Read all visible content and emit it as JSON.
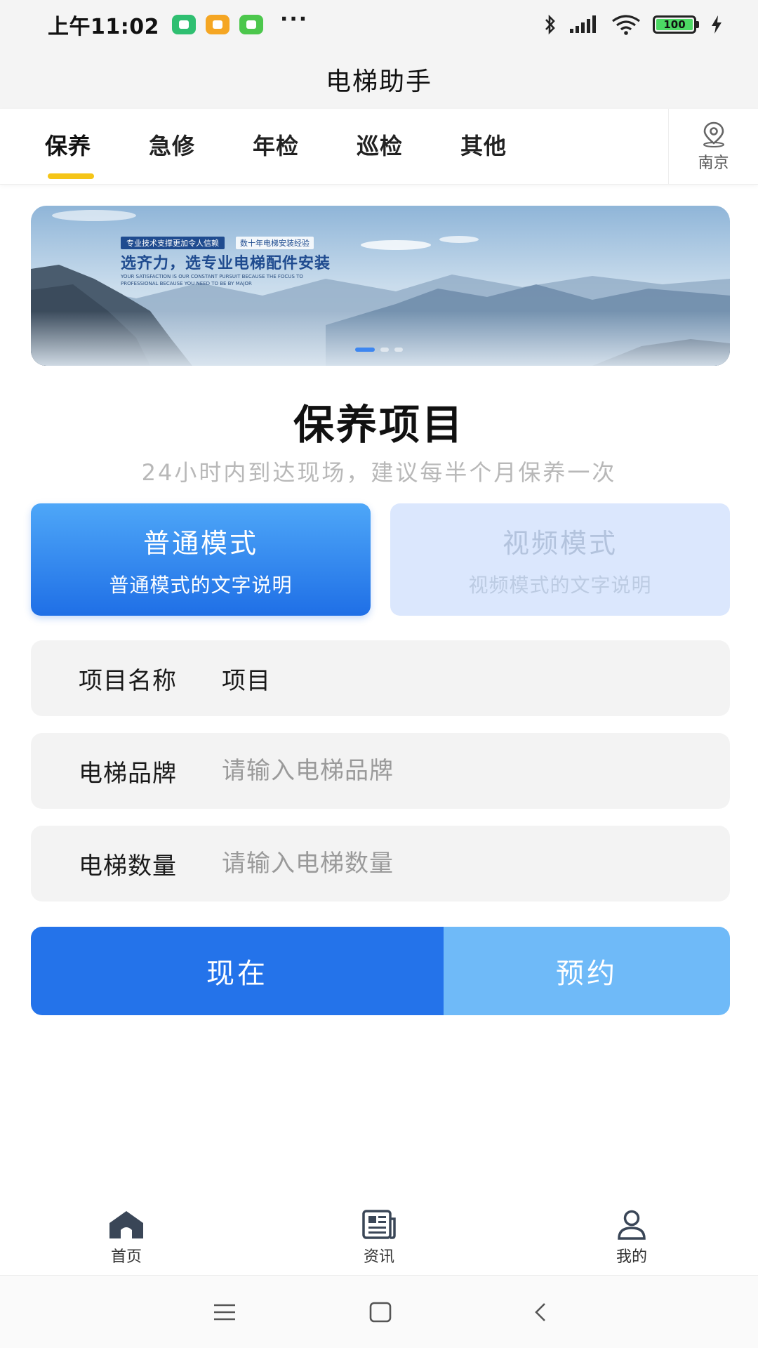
{
  "status_bar": {
    "time": "上午11:02",
    "notification_icons": [
      "shield-app-icon",
      "message-app-icon",
      "wechat-app-icon"
    ],
    "more": "···",
    "battery": "100",
    "colors": {
      "green": "#2fbf71",
      "orange": "#f5a623",
      "battery_fill": "#4cd964"
    }
  },
  "header": {
    "title": "电梯助手"
  },
  "tabs": {
    "items": [
      {
        "label": "保养",
        "active": true
      },
      {
        "label": "急修",
        "active": false
      },
      {
        "label": "年检",
        "active": false
      },
      {
        "label": "巡检",
        "active": false
      },
      {
        "label": "其他",
        "active": false
      }
    ],
    "location": {
      "icon": "location-pin-icon",
      "label": "南京"
    },
    "accent": "#f5c518"
  },
  "banner": {
    "tag": "专业技术支撑更加令人信赖",
    "tag2": "数十年电梯安装经验",
    "headline": "选齐力，选专业电梯配件安装",
    "subline": "YOUR SATISFACTION IS OUR CONSTANT PURSUIT BECAUSE THE FOCUS TO PROFESSIONAL BECAUSE YOU NEED TO BE BY MAJOR"
  },
  "section": {
    "title": "保养项目",
    "subtitle": "24小时内到达现场，建议每半个月保养一次"
  },
  "modes": [
    {
      "title": "普通模式",
      "desc": "普通模式的文字说明",
      "active": true
    },
    {
      "title": "视频模式",
      "desc": "视频模式的文字说明",
      "active": false
    }
  ],
  "form": {
    "project": {
      "label": "项目名称",
      "value": "项目",
      "placeholder": ""
    },
    "brand": {
      "label": "电梯品牌",
      "value": "",
      "placeholder": "请输入电梯品牌"
    },
    "count": {
      "label": "电梯数量",
      "value": "",
      "placeholder": "请输入电梯数量"
    }
  },
  "actions": {
    "now": "现在",
    "book": "预约",
    "colors": {
      "now": "#2473ea",
      "book": "#6fbaf8"
    }
  },
  "bottom_nav": [
    {
      "label": "首页",
      "icon": "home-icon"
    },
    {
      "label": "资讯",
      "icon": "news-icon"
    },
    {
      "label": "我的",
      "icon": "user-icon"
    }
  ],
  "system_nav": [
    "menu-icon",
    "home-square-icon",
    "back-icon"
  ]
}
